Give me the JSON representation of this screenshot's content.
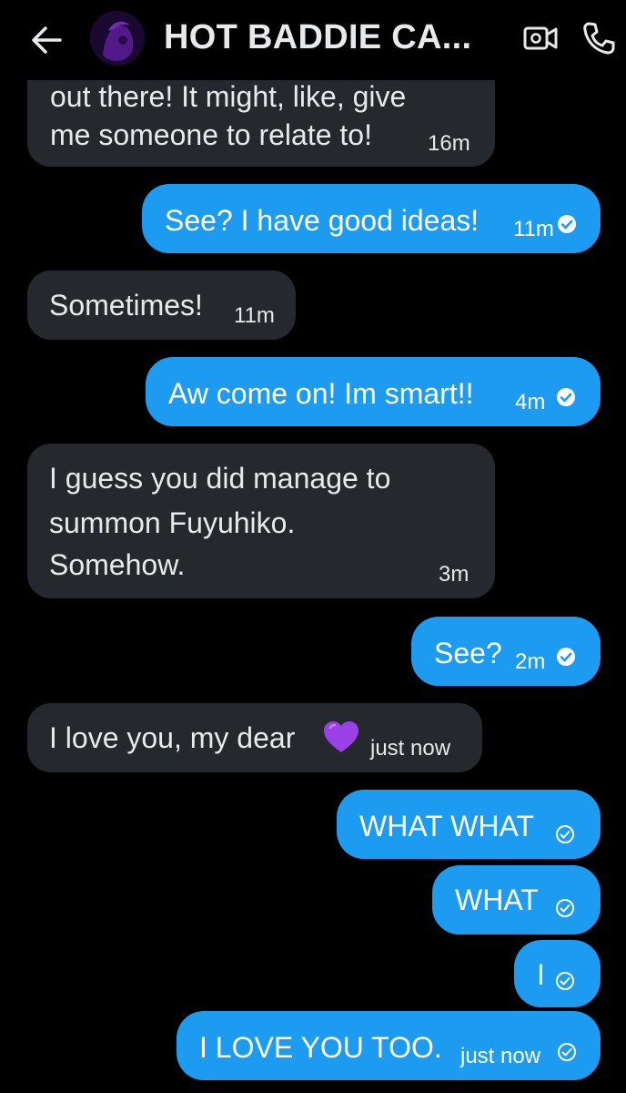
{
  "header": {
    "title": "HOT BADDIE CA...",
    "back_icon": "back-arrow-icon",
    "video_icon": "video-call-icon",
    "phone_icon": "phone-call-icon"
  },
  "messages": [
    {
      "side": "received",
      "lines": [
        "out there! It might, like, give",
        "me someone to relate to!"
      ],
      "time": "16m"
    },
    {
      "side": "sent",
      "lines": [
        "See? I have good ideas!"
      ],
      "time": "11m",
      "status": "seen"
    },
    {
      "side": "received",
      "lines": [
        "Sometimes!"
      ],
      "time": "11m"
    },
    {
      "side": "sent",
      "lines": [
        "Aw come on! Im smart!!"
      ],
      "time": "4m",
      "status": "seen"
    },
    {
      "side": "received",
      "lines": [
        "I guess you did manage to",
        "summon Fuyuhiko.",
        "Somehow."
      ],
      "time": "3m"
    },
    {
      "side": "sent",
      "lines": [
        "See?"
      ],
      "time": "2m",
      "status": "seen"
    },
    {
      "side": "received",
      "lines": [
        "I love you, my dear"
      ],
      "emoji": "purple-heart",
      "time": "just now"
    },
    {
      "side": "sent",
      "lines": [
        "WHAT WHAT"
      ],
      "status": "sent"
    },
    {
      "side": "sent",
      "lines": [
        "WHAT"
      ],
      "status": "sent"
    },
    {
      "side": "sent",
      "lines": [
        "I"
      ],
      "status": "sent"
    },
    {
      "side": "sent",
      "lines": [
        "I LOVE YOU TOO."
      ],
      "time": "just now",
      "status": "sent"
    }
  ],
  "colors": {
    "background": "#000000",
    "received_bubble": "#25292d",
    "sent_bubble": "#1d9bf0",
    "text": "#e7e9ea",
    "heart": "#9b3fe6"
  }
}
